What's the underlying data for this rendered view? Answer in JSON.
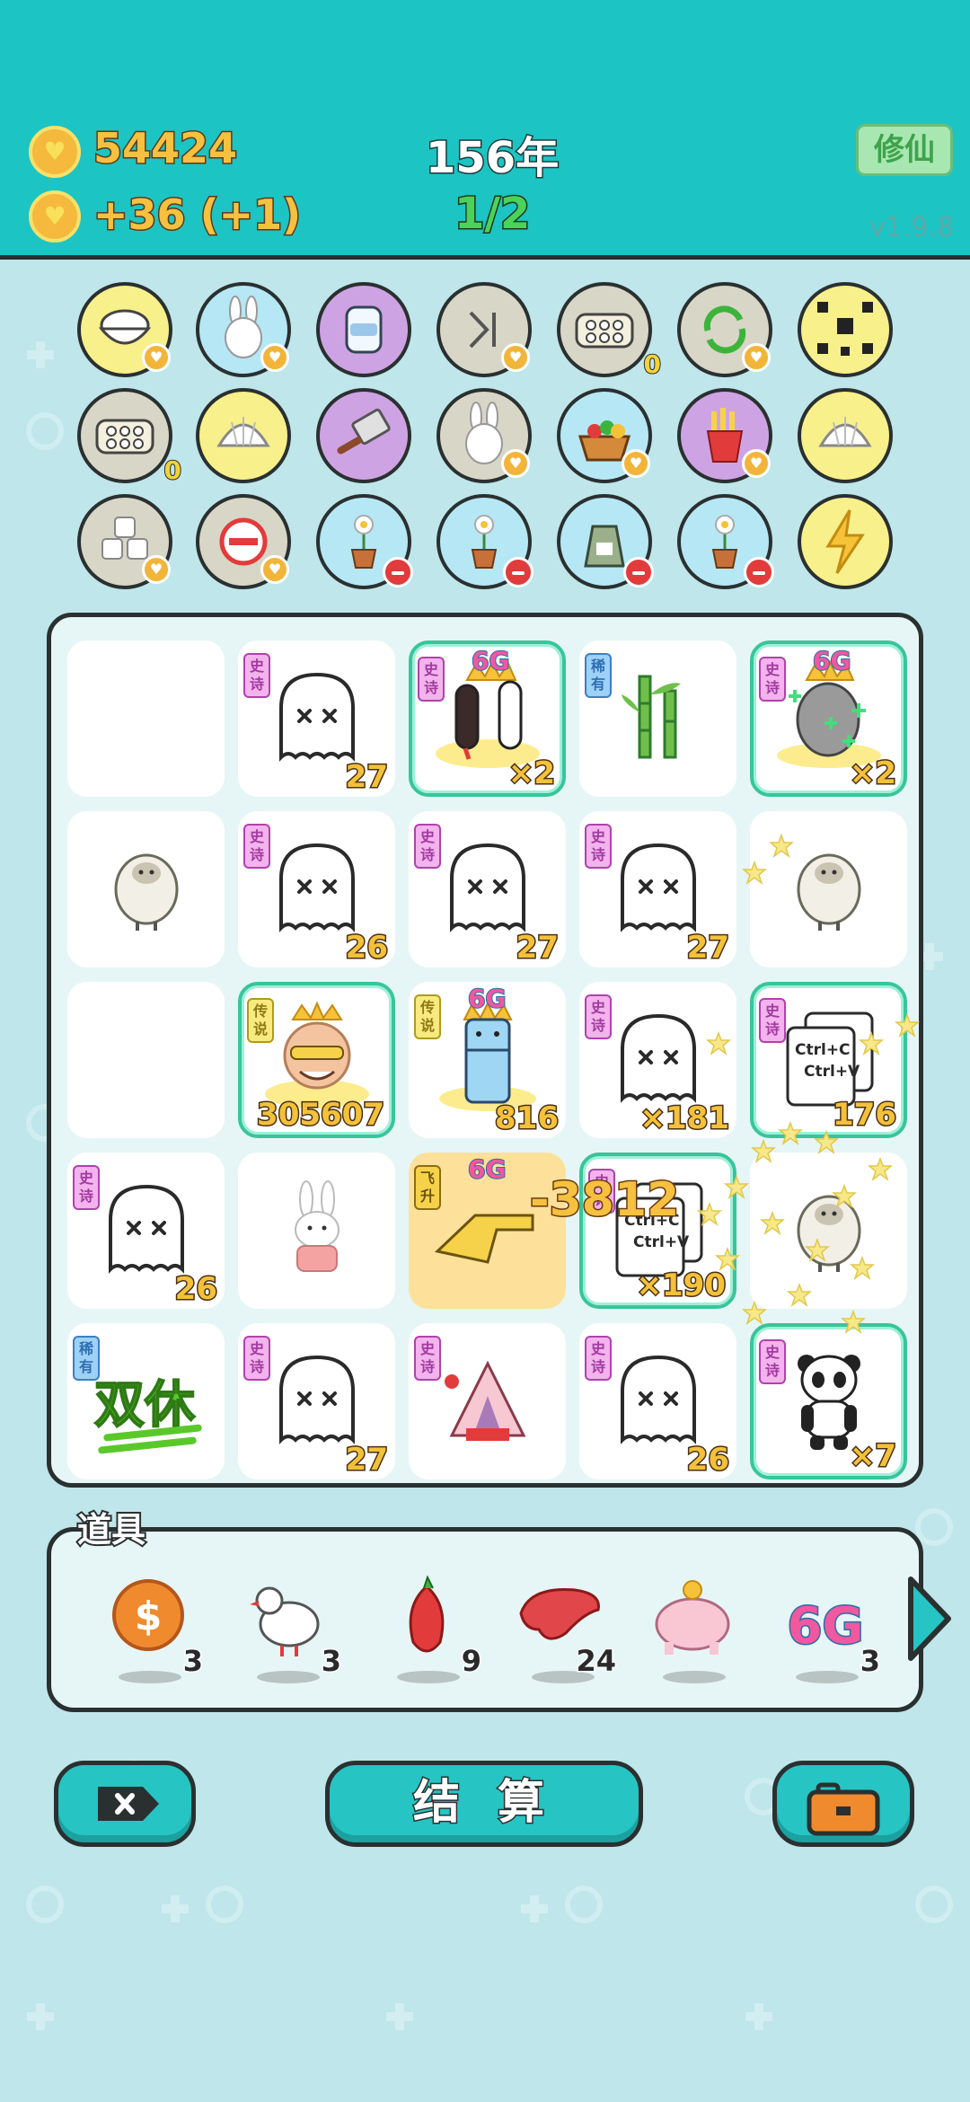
{
  "header": {
    "coins": "54424",
    "income": "+36  (+1)",
    "year": "156年",
    "round": "1/2",
    "xiuxian_label": "修仙",
    "version": "v1.9.8"
  },
  "tokens": [
    {
      "row": 0,
      "col": 0,
      "name": "rice-bowl-token",
      "color": "yellow",
      "badge": "heart"
    },
    {
      "row": 0,
      "col": 1,
      "name": "rabbit-token",
      "color": "blue",
      "badge": "heart"
    },
    {
      "row": 0,
      "col": 2,
      "name": "milk-jar-token",
      "color": "purple",
      "badge": "none"
    },
    {
      "row": 0,
      "col": 3,
      "name": "skip-token",
      "color": "gray",
      "badge": "heart"
    },
    {
      "row": 0,
      "col": 4,
      "name": "egg-tray-token",
      "color": "gray",
      "badge": "zero",
      "badge_text": "0"
    },
    {
      "row": 0,
      "col": 5,
      "name": "refresh-token",
      "color": "gray",
      "badge": "heart"
    },
    {
      "row": 0,
      "col": 6,
      "name": "wang-wang-token",
      "color": "yellow",
      "badge": "none"
    },
    {
      "row": 1,
      "col": 0,
      "name": "egg-tray-token",
      "color": "gray",
      "badge": "zero",
      "badge_text": "0"
    },
    {
      "row": 1,
      "col": 1,
      "name": "shell-token",
      "color": "yellow",
      "badge": "none"
    },
    {
      "row": 1,
      "col": 2,
      "name": "cleaver-token",
      "color": "purple",
      "badge": "none"
    },
    {
      "row": 1,
      "col": 3,
      "name": "rabbit-token",
      "color": "gray",
      "badge": "heart"
    },
    {
      "row": 1,
      "col": 4,
      "name": "fruit-basket-token",
      "color": "blue",
      "badge": "heart"
    },
    {
      "row": 1,
      "col": 5,
      "name": "fries-token",
      "color": "purple",
      "badge": "heart"
    },
    {
      "row": 1,
      "col": 6,
      "name": "shell-token",
      "color": "yellow",
      "badge": "none"
    },
    {
      "row": 2,
      "col": 0,
      "name": "sugar-cubes-token",
      "color": "gray",
      "badge": "heart"
    },
    {
      "row": 2,
      "col": 1,
      "name": "no-entry-token",
      "color": "gray",
      "badge": "heart"
    },
    {
      "row": 2,
      "col": 2,
      "name": "flower-pot-token",
      "color": "blue",
      "badge": "minus"
    },
    {
      "row": 2,
      "col": 3,
      "name": "flower-pot-token",
      "color": "blue",
      "badge": "minus"
    },
    {
      "row": 2,
      "col": 4,
      "name": "trash-bag-token",
      "color": "blue",
      "badge": "minus"
    },
    {
      "row": 2,
      "col": 5,
      "name": "flower-pot-token",
      "color": "blue",
      "badge": "minus"
    },
    {
      "row": 2,
      "col": 6,
      "name": "lightning-token",
      "color": "yellow",
      "badge": "none"
    }
  ],
  "board": [
    {
      "row": 0,
      "col": 0,
      "item": "empty",
      "tag": "",
      "num": ""
    },
    {
      "row": 0,
      "col": 1,
      "item": "ghost",
      "tag": "史诗",
      "tagtype": "shi",
      "num": "27"
    },
    {
      "row": 0,
      "col": 2,
      "item": "scroll",
      "tag": "史诗",
      "tagtype": "shi",
      "num": "×2",
      "sixg": "6G",
      "hl": true
    },
    {
      "row": 0,
      "col": 3,
      "item": "bamboo",
      "tag": "稀有",
      "tagtype": "xi",
      "num": ""
    },
    {
      "row": 0,
      "col": 4,
      "item": "zombie-king",
      "tag": "史诗",
      "tagtype": "shi",
      "num": "×2",
      "sixg": "6G",
      "hl": true
    },
    {
      "row": 1,
      "col": 0,
      "item": "sheep",
      "tag": "",
      "num": ""
    },
    {
      "row": 1,
      "col": 1,
      "item": "ghost",
      "tag": "史诗",
      "tagtype": "shi",
      "num": "26"
    },
    {
      "row": 1,
      "col": 2,
      "item": "ghost",
      "tag": "史诗",
      "tagtype": "shi",
      "num": "27"
    },
    {
      "row": 1,
      "col": 3,
      "item": "ghost",
      "tag": "史诗",
      "tagtype": "shi",
      "num": "27"
    },
    {
      "row": 1,
      "col": 4,
      "item": "sheep",
      "tag": "",
      "num": ""
    },
    {
      "row": 2,
      "col": 0,
      "item": "empty",
      "tag": "",
      "num": ""
    },
    {
      "row": 2,
      "col": 1,
      "item": "old-king",
      "tag": "传说",
      "tagtype": "chuan",
      "num": "305607",
      "hl": true
    },
    {
      "row": 2,
      "col": 2,
      "item": "fridge",
      "tag": "传说",
      "tagtype": "chuan",
      "num": "816",
      "sixg": "6G"
    },
    {
      "row": 2,
      "col": 3,
      "item": "ghost",
      "tag": "史诗",
      "tagtype": "shi",
      "num": "×181"
    },
    {
      "row": 2,
      "col": 4,
      "item": "ctrl-cv",
      "tag": "史诗",
      "tagtype": "shi",
      "num": "176",
      "hl": true
    },
    {
      "row": 3,
      "col": 0,
      "item": "ghost",
      "tag": "史诗",
      "tagtype": "shi",
      "num": "26"
    },
    {
      "row": 3,
      "col": 1,
      "item": "rabbit",
      "tag": "",
      "num": ""
    },
    {
      "row": 3,
      "col": 2,
      "item": "hand",
      "tag": "飞升",
      "tagtype": "fei",
      "num": "",
      "sixg": "6G",
      "gold": true
    },
    {
      "row": 3,
      "col": 3,
      "item": "ctrl-cv",
      "tag": "史诗",
      "tagtype": "shi",
      "num": "×190",
      "hl": true
    },
    {
      "row": 3,
      "col": 4,
      "item": "sheep",
      "tag": "",
      "num": ""
    },
    {
      "row": 4,
      "col": 0,
      "item": "shuangxiu",
      "tag": "稀有",
      "tagtype": "xi",
      "num": ""
    },
    {
      "row": 4,
      "col": 1,
      "item": "ghost",
      "tag": "史诗",
      "tagtype": "shi",
      "num": "27"
    },
    {
      "row": 4,
      "col": 2,
      "item": "rabbit-house",
      "tag": "史诗",
      "tagtype": "shi",
      "num": ""
    },
    {
      "row": 4,
      "col": 3,
      "item": "ghost",
      "tag": "史诗",
      "tagtype": "shi",
      "num": "26"
    },
    {
      "row": 4,
      "col": 4,
      "item": "panda",
      "tag": "史诗",
      "tagtype": "shi",
      "num": "×7",
      "hl": true
    }
  ],
  "board_texts": {
    "shuangxiu": "双休",
    "ctrl_c": "Ctrl+C",
    "ctrl_v": "Ctrl+V",
    "float_delta": "-3812"
  },
  "props": {
    "label": "道具",
    "items": [
      {
        "name": "coin-prop",
        "count": "3"
      },
      {
        "name": "bird-prop",
        "count": "3"
      },
      {
        "name": "chili-prop",
        "count": "9"
      },
      {
        "name": "liver-prop",
        "count": "24"
      },
      {
        "name": "piggy-bank-prop",
        "count": ""
      },
      {
        "name": "6g-prop",
        "count": "3",
        "text": "6G"
      }
    ]
  },
  "buttons": {
    "settle": "结 算"
  },
  "colors": {
    "header_bg": "#1dc4c4",
    "coin": "#f4b93d",
    "epic_tag": "#f3b3ec",
    "rare_tag": "#9ed1f6",
    "legend_tag": "#f8ea7e",
    "highlight": "#38c59a"
  }
}
